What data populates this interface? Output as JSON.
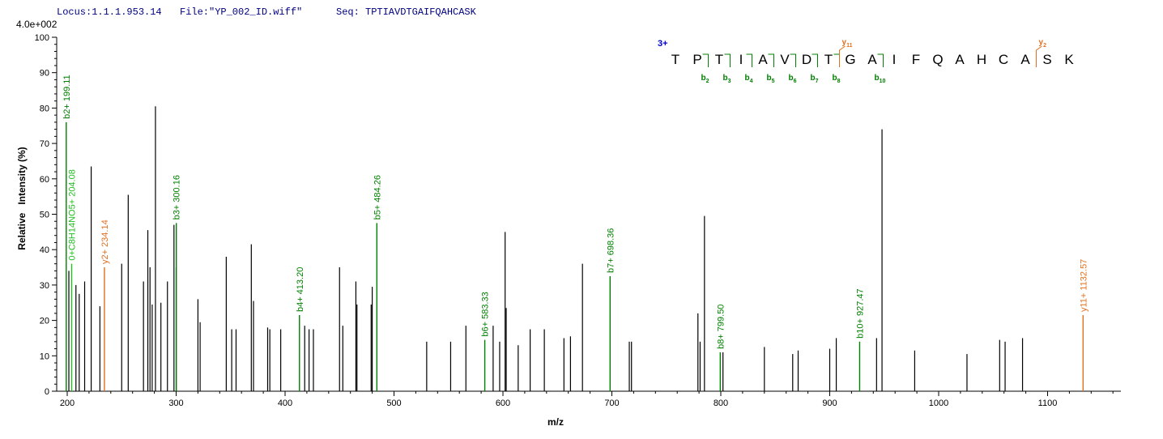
{
  "header": {
    "locus": "Locus:1.1.1.953.14",
    "file": "File:\"YP_002_ID.wiff\"",
    "seq": "Seq: TPTIAVDTGAIFQAHCASK",
    "scale": "4.0e+002"
  },
  "chart_data": {
    "type": "bar",
    "xlabel": "m/z",
    "ylabel": "Relative   Intensity (%)",
    "xlim": [
      200,
      1170
    ],
    "ylim": [
      0,
      100
    ],
    "xticks": [
      200,
      300,
      400,
      500,
      600,
      700,
      800,
      900,
      1000,
      1100
    ],
    "yticks": [
      0,
      10,
      20,
      30,
      40,
      50,
      60,
      70,
      80,
      90,
      100
    ],
    "colors": {
      "unassigned": "#000000",
      "b_ion": "#008000",
      "y_ion": "#e07020",
      "other": "#20c020",
      "charge": "#0000cc"
    },
    "peaks_unassigned": [
      [
        201.5,
        34
      ],
      [
        208,
        30
      ],
      [
        211,
        27.5
      ],
      [
        216,
        31
      ],
      [
        222,
        63.5
      ],
      [
        230,
        24
      ],
      [
        250,
        36
      ],
      [
        256,
        55.5
      ],
      [
        270,
        31
      ],
      [
        274,
        45.5
      ],
      [
        276,
        35
      ],
      [
        278,
        24.5
      ],
      [
        281,
        80.5
      ],
      [
        286,
        25
      ],
      [
        292,
        31
      ],
      [
        298,
        47
      ],
      [
        300,
        35
      ],
      [
        320,
        26
      ],
      [
        322,
        19.5
      ],
      [
        346,
        38
      ],
      [
        351,
        17.5
      ],
      [
        355,
        17.5
      ],
      [
        369,
        41.5
      ],
      [
        371,
        25.5
      ],
      [
        384,
        18
      ],
      [
        386,
        17.5
      ],
      [
        396,
        17.5
      ],
      [
        418,
        18.5
      ],
      [
        422,
        17.5
      ],
      [
        426,
        17.5
      ],
      [
        450,
        35
      ],
      [
        453,
        18.5
      ],
      [
        465,
        31
      ],
      [
        466,
        24.5
      ],
      [
        479,
        24.5
      ],
      [
        480,
        29.5
      ],
      [
        530,
        14
      ],
      [
        552,
        14
      ],
      [
        566,
        18.5
      ],
      [
        591,
        18.5
      ],
      [
        597,
        14
      ],
      [
        602,
        45
      ],
      [
        603,
        23.5
      ],
      [
        614,
        13
      ],
      [
        625,
        17.5
      ],
      [
        638,
        17.5
      ],
      [
        656,
        15
      ],
      [
        662,
        15.5
      ],
      [
        673,
        36
      ],
      [
        716,
        14
      ],
      [
        718,
        14
      ],
      [
        779,
        22
      ],
      [
        781,
        14
      ],
      [
        785,
        49.5
      ],
      [
        802,
        11
      ],
      [
        840,
        12.5
      ],
      [
        866,
        10.5
      ],
      [
        871,
        11.5
      ],
      [
        900,
        12
      ],
      [
        906,
        15
      ],
      [
        943,
        15
      ],
      [
        948,
        74
      ],
      [
        978,
        11.5
      ],
      [
        1026,
        10.5
      ],
      [
        1056,
        14.5
      ],
      [
        1061,
        14
      ],
      [
        1077,
        15
      ]
    ],
    "annotated_peaks": [
      {
        "mz": 199.11,
        "intensity": 76,
        "label": "b2+ 199.11",
        "ion": "b"
      },
      {
        "mz": 204.08,
        "intensity": 36,
        "label": "0+C8H14NO5+ 204.08",
        "ion": "other"
      },
      {
        "mz": 234.14,
        "intensity": 35,
        "label": "y2+ 234.14",
        "ion": "y"
      },
      {
        "mz": 300.16,
        "intensity": 47.5,
        "label": "b3+ 300.16",
        "ion": "b"
      },
      {
        "mz": 413.2,
        "intensity": 21.5,
        "label": "b4+ 413.20",
        "ion": "b"
      },
      {
        "mz": 484.26,
        "intensity": 47.5,
        "label": "b5+ 484.26",
        "ion": "b"
      },
      {
        "mz": 583.33,
        "intensity": 14.5,
        "label": "b6+ 583.33",
        "ion": "b"
      },
      {
        "mz": 698.36,
        "intensity": 32.5,
        "label": "b7+ 698.36",
        "ion": "b"
      },
      {
        "mz": 799.5,
        "intensity": 11,
        "label": "b8+ 799.50",
        "ion": "b"
      },
      {
        "mz": 927.47,
        "intensity": 14,
        "label": "b10+ 927.47",
        "ion": "b"
      },
      {
        "mz": 1132.57,
        "intensity": 21.5,
        "label": "y11+ 1132.57",
        "ion": "y"
      }
    ],
    "sequence": {
      "charge": "3+",
      "residues": [
        "T",
        "P",
        "T",
        "I",
        "A",
        "V",
        "D",
        "T",
        "G",
        "A",
        "I",
        "F",
        "Q",
        "A",
        "H",
        "C",
        "A",
        "S",
        "K"
      ],
      "b_ions": [
        {
          "after": 2,
          "label": "b",
          "sub": "2"
        },
        {
          "after": 3,
          "label": "b",
          "sub": "3"
        },
        {
          "after": 4,
          "label": "b",
          "sub": "4"
        },
        {
          "after": 5,
          "label": "b",
          "sub": "5"
        },
        {
          "after": 6,
          "label": "b",
          "sub": "6"
        },
        {
          "after": 7,
          "label": "b",
          "sub": "7"
        },
        {
          "after": 8,
          "label": "b",
          "sub": "8"
        },
        {
          "after": 10,
          "label": "b",
          "sub": "10"
        }
      ],
      "y_ions": [
        {
          "after": 8,
          "label": "y",
          "sub": "11"
        },
        {
          "after": 17,
          "label": "y",
          "sub": "2"
        }
      ]
    }
  }
}
